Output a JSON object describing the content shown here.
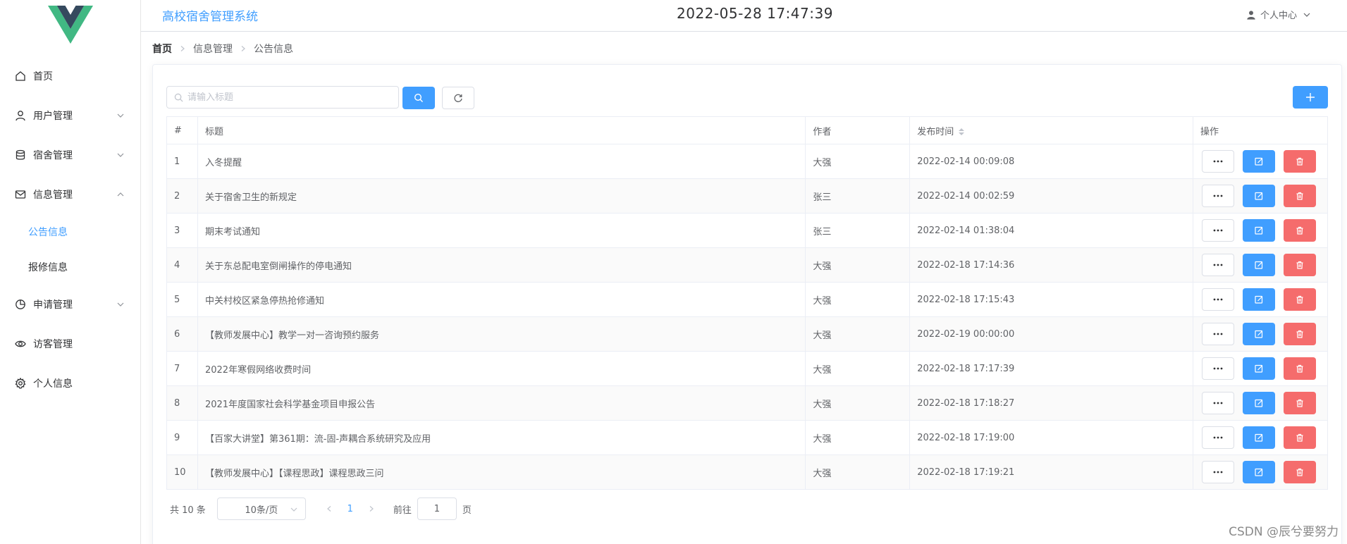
{
  "app": {
    "title": "高校宿舍管理系统",
    "clock": "2022-05-28 17:47:39",
    "user_menu": "个人中心"
  },
  "sidebar": {
    "items": [
      {
        "label": "首页",
        "icon": "home-icon"
      },
      {
        "label": "用户管理",
        "icon": "user-icon",
        "expand": "collapsed"
      },
      {
        "label": "宿舍管理",
        "icon": "database-icon",
        "expand": "collapsed"
      },
      {
        "label": "信息管理",
        "icon": "mail-icon",
        "expand": "expanded"
      },
      {
        "label": "申请管理",
        "icon": "pie-chart-icon",
        "expand": "collapsed"
      },
      {
        "label": "访客管理",
        "icon": "eye-icon"
      },
      {
        "label": "个人信息",
        "icon": "gear-icon"
      }
    ],
    "submenu": [
      {
        "label": "公告信息",
        "active": true
      },
      {
        "label": "报修信息",
        "active": false
      }
    ]
  },
  "breadcrumb": [
    "首页",
    "信息管理",
    "公告信息"
  ],
  "search": {
    "placeholder": "请输入标题",
    "value": ""
  },
  "table": {
    "headers": [
      "#",
      "标题",
      "作者",
      "发布时间",
      "操作"
    ],
    "rows": [
      {
        "num": "1",
        "title": "入冬提醒",
        "author": "大强",
        "time": "2022-02-14 00:09:08"
      },
      {
        "num": "2",
        "title": "关于宿舍卫生的新规定",
        "author": "张三",
        "time": "2022-02-14 00:02:59"
      },
      {
        "num": "3",
        "title": "期末考试通知",
        "author": "张三",
        "time": "2022-02-14 01:38:04"
      },
      {
        "num": "4",
        "title": "关于东总配电室倒闸操作的停电通知",
        "author": "大强",
        "time": "2022-02-18 17:14:36"
      },
      {
        "num": "5",
        "title": "中关村校区紧急停热抢修通知",
        "author": "大强",
        "time": "2022-02-18 17:15:43"
      },
      {
        "num": "6",
        "title": "【教师发展中心】教学一对一咨询预约服务",
        "author": "大强",
        "time": "2022-02-19 00:00:00"
      },
      {
        "num": "7",
        "title": "2022年寒假网络收费时间",
        "author": "大强",
        "time": "2022-02-18 17:17:39"
      },
      {
        "num": "8",
        "title": "2021年度国家社会科学基金项目申报公告",
        "author": "大强",
        "time": "2022-02-18 17:18:27"
      },
      {
        "num": "9",
        "title": "【百家大讲堂】第361期：流-固-声耦合系统研究及应用",
        "author": "大强",
        "time": "2022-02-18 17:19:00"
      },
      {
        "num": "10",
        "title": "【教师发展中心】【课程思政】课程思政三问",
        "author": "大强",
        "time": "2022-02-18 17:19:21"
      }
    ]
  },
  "pagination": {
    "total": "共 10 条",
    "page_size": "10条/页",
    "current": "1",
    "goto_label": "前往",
    "goto_value": "1",
    "goto_unit": "页"
  },
  "watermark": "CSDN @辰兮要努力",
  "colors": {
    "primary": "#409eff",
    "danger": "#f56c6c",
    "logo_green": "#41b883",
    "logo_dark": "#35495e"
  }
}
